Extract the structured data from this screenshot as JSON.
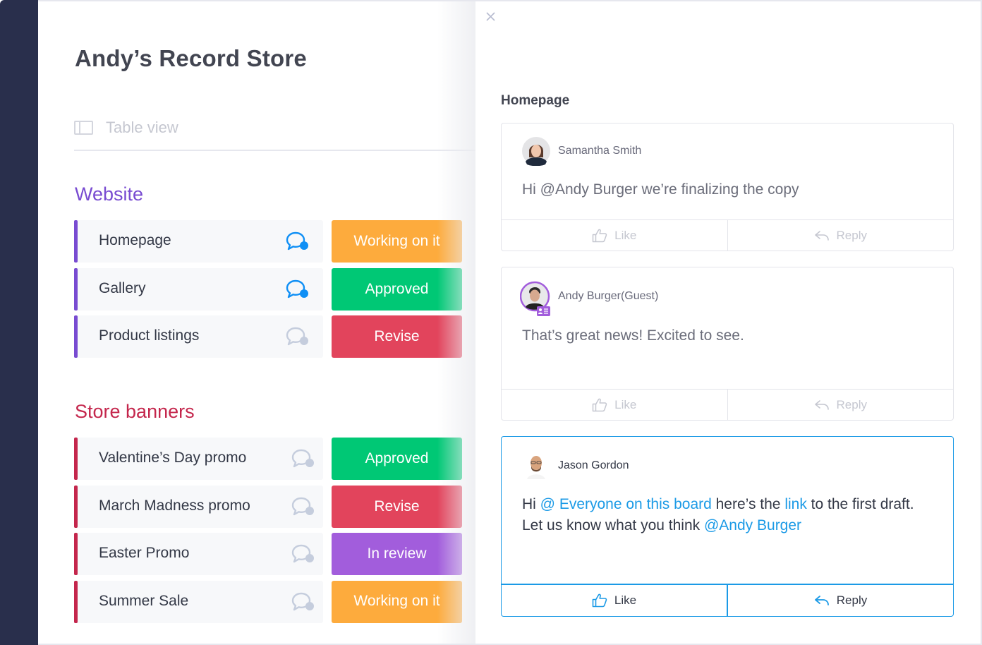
{
  "board": {
    "title": "Andy’s Record Store",
    "view_label": "Table view",
    "groups": [
      {
        "title": "Website",
        "color": "#784bd1",
        "items": [
          {
            "name": "Homepage",
            "status": "Working on it",
            "status_color": "#fdab3d",
            "has_updates": true
          },
          {
            "name": "Gallery",
            "status": "Approved",
            "status_color": "#00c875",
            "has_updates": true
          },
          {
            "name": "Product listings",
            "status": "Revise",
            "status_color": "#e2445c",
            "has_updates": false
          }
        ]
      },
      {
        "title": "Store banners",
        "color": "#c4264c",
        "items": [
          {
            "name": "Valentine’s Day promo",
            "status": "Approved",
            "status_color": "#00c875",
            "has_updates": false
          },
          {
            "name": "March Madness promo",
            "status": "Revise",
            "status_color": "#e2445c",
            "has_updates": false
          },
          {
            "name": "Easter Promo",
            "status": "In review",
            "status_color": "#a25ddc",
            "has_updates": false
          },
          {
            "name": "Summer Sale",
            "status": "Working on it",
            "status_color": "#fdab3d",
            "has_updates": false
          }
        ]
      }
    ]
  },
  "panel": {
    "title": "Homepage",
    "close_icon": "close-icon",
    "updates": [
      {
        "author": "Samantha Smith",
        "body_parts": [
          {
            "text": "Hi @Andy Burger we’re finalizing the copy",
            "mention": false
          }
        ],
        "like_label": "Like",
        "reply_label": "Reply"
      },
      {
        "author": "Andy Burger(Guest)",
        "guest_badge": true,
        "body_parts": [
          {
            "text": "That’s great news! Excited to see.",
            "mention": false
          }
        ],
        "like_label": "Like",
        "reply_label": "Reply"
      },
      {
        "author": "Jason Gordon",
        "active": true,
        "body_parts": [
          {
            "text": "Hi ",
            "mention": false
          },
          {
            "text": "@ Everyone on this board",
            "mention": true
          },
          {
            "text": " here’s the ",
            "mention": false
          },
          {
            "text": "link",
            "mention": true
          },
          {
            "text": " to the first draft. Let us know what you think ",
            "mention": false
          },
          {
            "text": "@Andy Burger",
            "mention": true
          }
        ],
        "like_label": "Like",
        "reply_label": "Reply"
      }
    ]
  },
  "colors": {
    "accent": "#1b9ae6",
    "rail": "#292f4c"
  }
}
